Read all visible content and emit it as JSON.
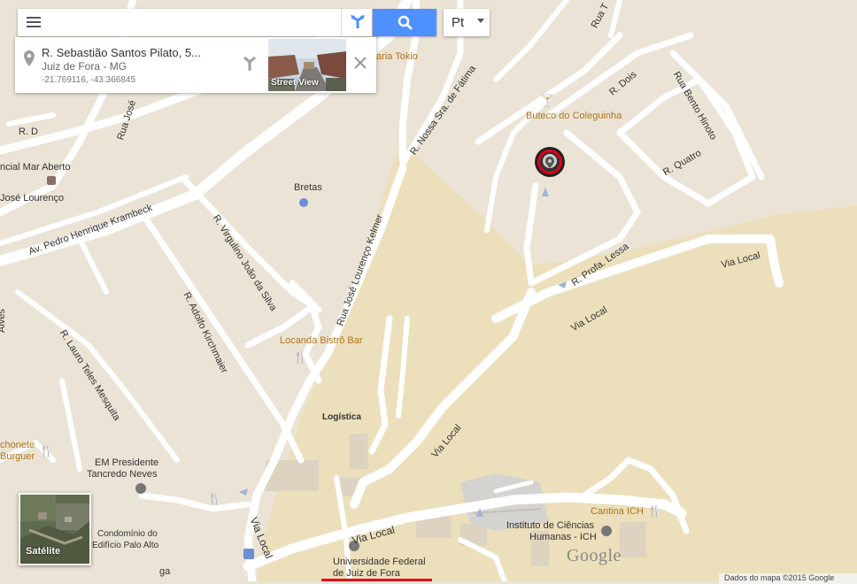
{
  "search": {
    "value": "",
    "placeholder": ""
  },
  "language_button": {
    "label": "Pt"
  },
  "place_card": {
    "address_line1": "R. Sebastião Santos Pilato, 5...",
    "address_line2": "Juiz de Fora - MG",
    "coordinates": "-21.769116, -43.366845",
    "street_view_label": "Street View"
  },
  "satellite_toggle": {
    "label": "Satélite"
  },
  "branding": {
    "logo_text": "Google",
    "attribution": "Dados do mapa ©2015 Google"
  },
  "colors": {
    "map_background": "#ebe4d6",
    "campus_area": "#ecdfbb",
    "road": "#ffffff",
    "search_button": "#4d90fe",
    "marker_ring": "#e1001a",
    "poi_text": "#b0731a"
  },
  "map_labels": {
    "streets": {
      "r_d": "R. D",
      "rua_jose": "Rua José",
      "av_pedro": "Av. Pedro Henrique Krambeck",
      "jose_lourenco_left": "José Lourenço",
      "r_virgulino": "R. Virgulino João da Silva",
      "r_adolfo": "R. Adolfo Kirchmaier",
      "r_lauro": "R. Lauro Teles Mesquita",
      "rua_jose_lourenco_kelmer": "Rua José Lourenço Kelmer",
      "r_nossa_sra": "R. Nossa Sra. de Fátima",
      "r_dois": "R. Dois",
      "rua_bento": "Rua Bento Hinoto",
      "r_quatro": "R. Quatro",
      "r_profa_lessa": "R. Profa. Lessa",
      "via_local_right": "Via Local",
      "via_local_mid": "Via Local",
      "via_local_diag": "Via Local",
      "via_local_bottom": "Via Local",
      "via_local_vertical": "Via Local",
      "rua_top": "Rua T",
      "alves_left": "Alves",
      "ga_left": "ga"
    },
    "pois": {
      "pizzaria_tokio": "aria Tokio",
      "buteco": "Buteco do Coleguinha",
      "bretas": "Bretas",
      "comercial": "ncial Mar Aberto",
      "locanda": "Locanda Bistrô Bar",
      "logistica": "Logística",
      "burger_line1": "chonete",
      "burger_line2": "Burguer",
      "em_line1": "EM Presidente",
      "em_line2": "Tancredo Neves",
      "condominio_line1": "Condomínio do",
      "condominio_line2": "Edifício Palo Alto",
      "cantina": "Cantina ICH",
      "ich_line1": "Instituto de Ciências",
      "ich_line2": "Humanas - ICH",
      "ufjf_line1": "Universidade Federal",
      "ufjf_line2": "de Juiz de Fora"
    }
  }
}
